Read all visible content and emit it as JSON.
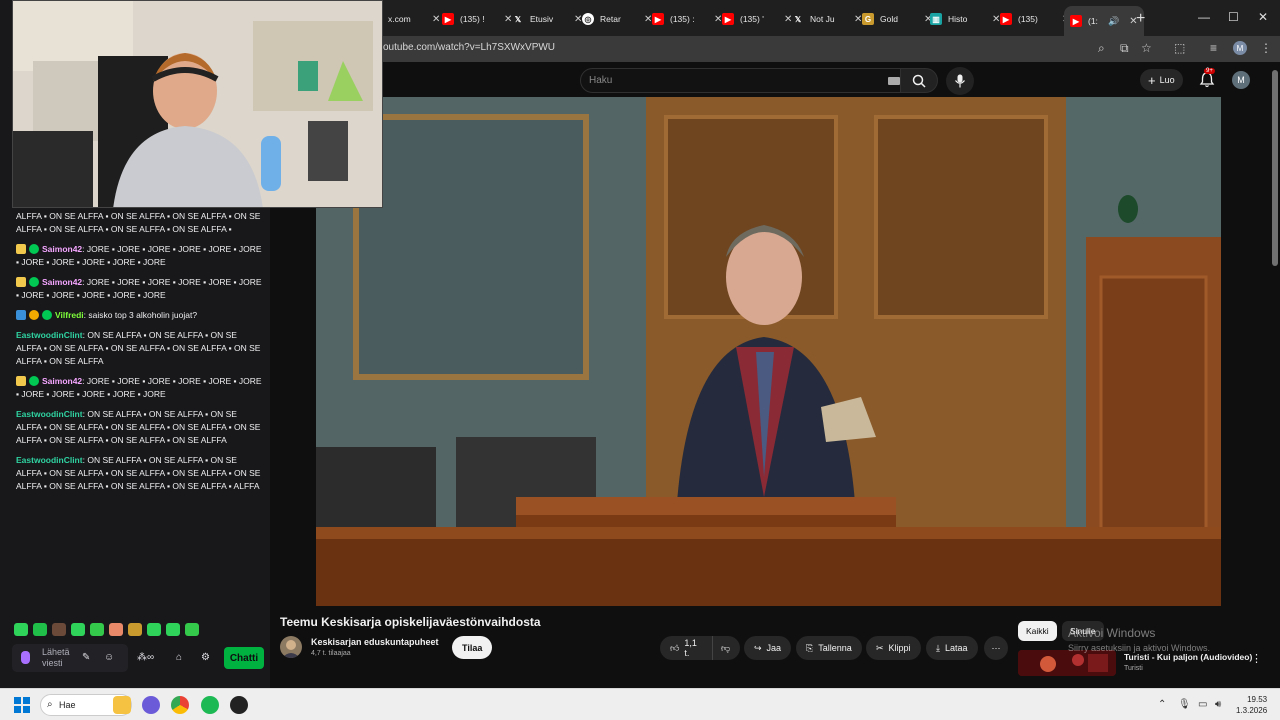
{
  "browser": {
    "tabs": [
      {
        "label": "x.com",
        "icon": "x-logo-icon",
        "color": "#000000"
      },
      {
        "label": "(135) !",
        "icon": "youtube-icon",
        "color": "#ff0000"
      },
      {
        "label": "Etusiv",
        "icon": "x-logo-icon",
        "color": "#000000"
      },
      {
        "label": "Retar",
        "icon": "globe-icon",
        "color": "#4a90d9"
      },
      {
        "label": "(135) :",
        "icon": "youtube-icon",
        "color": "#ff0000"
      },
      {
        "label": "(135) '",
        "icon": "youtube-icon",
        "color": "#ff0000"
      },
      {
        "label": "Not Ju",
        "icon": "x-logo-icon",
        "color": "#000000"
      },
      {
        "label": "Gold",
        "icon": "gold-icon",
        "color": "#c99a2e"
      },
      {
        "label": "Histo",
        "icon": "chart-icon",
        "color": "#1aa3a3"
      },
      {
        "label": "(135)",
        "icon": "youtube-icon",
        "color": "#ff0000"
      },
      {
        "label": "(1:",
        "icon": "youtube-icon",
        "color": "#ff0000"
      }
    ],
    "new_tab": "+",
    "url": "outube.com/watch?v=Lh7SXWxVPWU",
    "profile_initial": "M"
  },
  "youtube": {
    "search_placeholder": "Haku",
    "create_label": "Luo",
    "notifications_badge": "9+",
    "avatar_initial": "M",
    "video": {
      "title": "Teemu Keskisarja opiskelijaväestönvaihdosta",
      "channel": "Keskisarjan eduskuntapuheet",
      "subscribers": "4,7 t. tilaajaa",
      "subscribe_label": "Tilaa",
      "likes": "1,1 t.",
      "share_label": "Jaa",
      "save_label": "Tallenna",
      "clip_label": "Klippi",
      "download_label": "Lataa"
    },
    "chips": [
      {
        "label": "Kaikki",
        "active": true
      },
      {
        "label": "Sinulle",
        "active": false
      }
    ],
    "recommended": {
      "title": "Turisti - Kui paljon (Audiovideo)",
      "channel": "Turisti"
    },
    "watermark": {
      "line1": "Aktivoi Windows",
      "line2": "Siirry asetuksiin ja aktivoi Windows."
    }
  },
  "chat": {
    "messages": [
      {
        "user": "",
        "user_color": "",
        "text": "ALFFA ▪ ON SE ALFFA ▪ ON SE ALFFA ▪ ON SE ALFFA ▪ ON SE ALFFA ▪ ON SE ALFFA ▪ ON SE ALFFA ▪ ON SE ALFFA ▪"
      },
      {
        "user": "Saimon42",
        "user_color": "#f5a6ff",
        "text": "JORE ▪ JORE ▪ JORE ▪ JORE ▪ JORE ▪ JORE ▪ JORE ▪ JORE ▪ JORE ▪ JORE ▪ JORE"
      },
      {
        "user": "Saimon42",
        "user_color": "#f5a6ff",
        "text": "JORE ▪ JORE ▪ JORE ▪ JORE ▪ JORE ▪ JORE ▪ JORE ▪ JORE ▪ JORE ▪ JORE ▪ JORE"
      },
      {
        "user": "Vilfredi",
        "user_color": "#7fff3a",
        "text": "saisko top 3 alkoholin juojat?"
      },
      {
        "user": "EastwoodinClint",
        "user_color": "#2fd3a0",
        "text": "ON SE ALFFA ▪ ON SE ALFFA ▪ ON SE ALFFA ▪ ON SE ALFFA ▪ ON SE ALFFA ▪ ON SE ALFFA ▪ ON SE ALFFA ▪ ON SE ALFFA"
      },
      {
        "user": "Saimon42",
        "user_color": "#f5a6ff",
        "text": "JORE ▪ JORE ▪ JORE ▪ JORE ▪ JORE ▪ JORE ▪ JORE ▪ JORE ▪ JORE ▪ JORE ▪ JORE"
      },
      {
        "user": "EastwoodinClint",
        "user_color": "#2fd3a0",
        "text": "ON SE ALFFA ▪ ON SE ALFFA ▪ ON SE ALFFA ▪ ON SE ALFFA ▪ ON SE ALFFA ▪ ON SE ALFFA ▪ ON SE ALFFA ▪ ON SE ALFFA ▪ ON SE ALFFA ▪ ON SE ALFFA"
      },
      {
        "user": "EastwoodinClint",
        "user_color": "#2fd3a0",
        "text": "ON SE ALFFA ▪ ON SE ALFFA ▪ ON SE ALFFA ▪ ON SE ALFFA ▪ ON SE ALFFA ▪ ON SE ALFFA ▪ ON SE ALFFA ▪ ON SE ALFFA ▪ ON SE ALFFA ▪ ON SE ALFFA ▪ ALFFA"
      }
    ],
    "input_placeholder": "Lähetä viesti",
    "chat_button": "Chatti"
  },
  "taskbar": {
    "search_label": "Hae",
    "time": "19.53",
    "date": "1.3.2026"
  },
  "colors": {
    "yt_bg": "#0f0f0f",
    "twitch_purple": "#a970ff",
    "chat_button_green": "#00b341",
    "taskbar_bg": "#eeeeee"
  }
}
